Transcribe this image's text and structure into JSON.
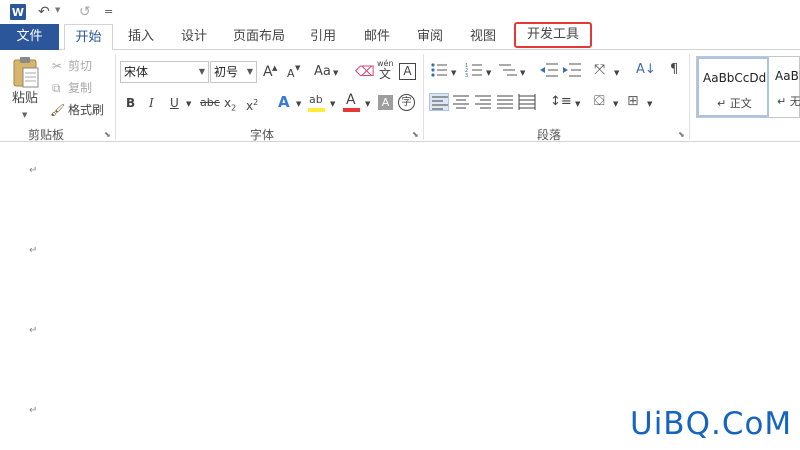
{
  "titlebar": {
    "logo": "W",
    "undo_icon": "undo-icon",
    "redo_icon": "redo-icon",
    "customize_caret": "="
  },
  "tabs": [
    {
      "label": "文件"
    },
    {
      "label": "开始"
    },
    {
      "label": "插入"
    },
    {
      "label": "设计"
    },
    {
      "label": "页面布局"
    },
    {
      "label": "引用"
    },
    {
      "label": "邮件"
    },
    {
      "label": "审阅"
    },
    {
      "label": "视图"
    },
    {
      "label": "开发工具"
    }
  ],
  "active_tab": "开始",
  "highlighted_tab": "开发工具",
  "clipboard": {
    "paste_label": "粘贴",
    "cut_label": "剪切",
    "copy_label": "复制",
    "format_painter_label": "格式刷",
    "group_label": "剪贴板"
  },
  "font": {
    "font_name": "宋体",
    "font_size": "初号",
    "grow": "A",
    "shrink": "A",
    "change_case": "Aa",
    "phonetic_top": "wén",
    "phonetic_bottom": "文",
    "border_char": "A",
    "bold": "B",
    "italic": "I",
    "underline": "U",
    "strike": "abc",
    "subscript_base": "x",
    "subscript_mark": "2",
    "superscript_base": "x",
    "superscript_mark": "2",
    "effects": "A",
    "highlight_char": "ab",
    "font_color_char": "A",
    "shading_char": "A",
    "enclose_char": "字",
    "group_label": "字体"
  },
  "paragraph": {
    "group_label": "段落"
  },
  "styles": {
    "items": [
      {
        "sample": "AaBbCcDd",
        "name": "↵ 正文"
      },
      {
        "sample": "AaBl",
        "name": "↵ 无"
      }
    ]
  },
  "colors": {
    "accent": "#2b579a",
    "highlight_border": "#e53935",
    "highlighter": "#ffeb3b",
    "font_color": "#e53935",
    "watermark": "#1565c0"
  },
  "document": {
    "paragraph_marks": [
      "↵",
      "↵",
      "↵",
      "↵"
    ]
  },
  "watermark": "UiBQ.CoM"
}
